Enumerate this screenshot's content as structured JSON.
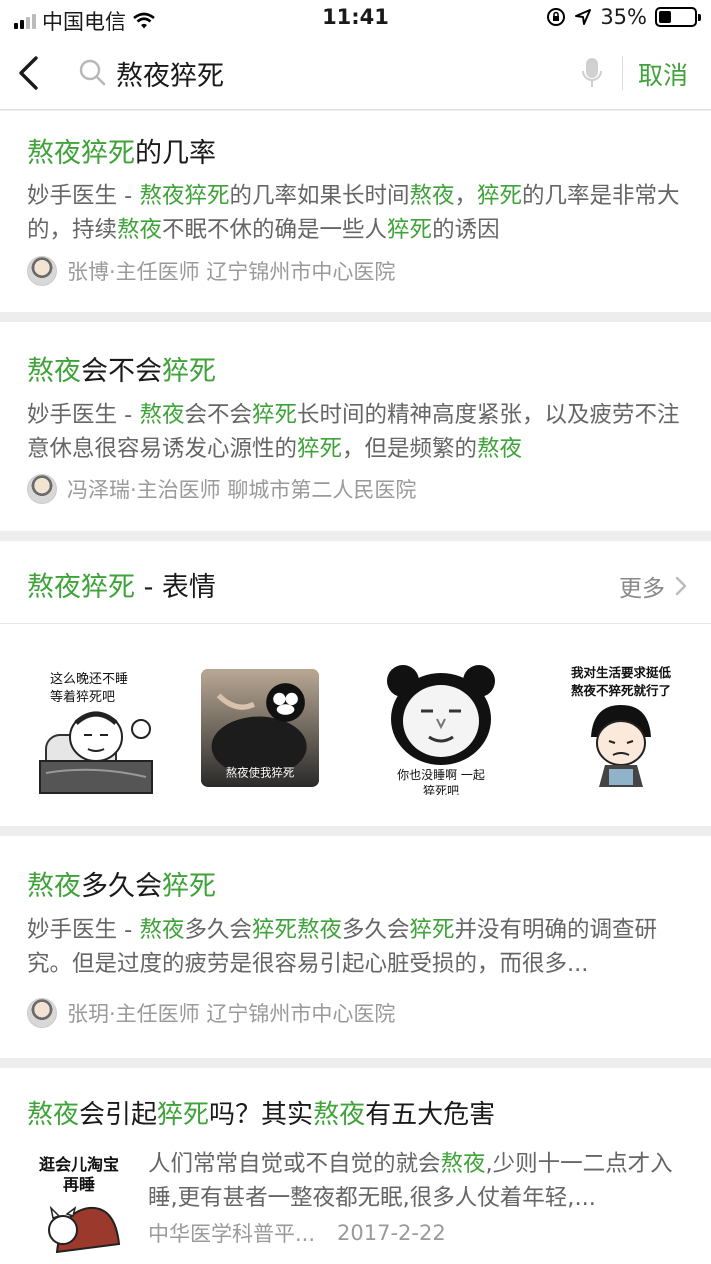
{
  "status_bar": {
    "carrier": "中国电信",
    "time": "11:41",
    "battery_percent": "35%",
    "battery_level": 0.35
  },
  "header": {
    "back_icon": "chevron-left-icon",
    "search_icon": "search-icon",
    "query": "熬夜猝死",
    "mic_icon": "mic-icon",
    "cancel_label": "取消"
  },
  "colors": {
    "accent": "#3fa33a",
    "text": "#1a1a1a",
    "muted": "#9a9a9a",
    "background": "#ededed"
  },
  "results": [
    {
      "title_parts": [
        {
          "text": "熬夜猝死",
          "hl": true
        },
        {
          "text": "的几率",
          "hl": false
        }
      ],
      "snippet_parts": [
        {
          "text": "妙手医生 - ",
          "hl": false
        },
        {
          "text": "熬夜猝死",
          "hl": true
        },
        {
          "text": "的几率如果长时间",
          "hl": false
        },
        {
          "text": "熬夜",
          "hl": true
        },
        {
          "text": "，",
          "hl": false
        },
        {
          "text": "猝死",
          "hl": true
        },
        {
          "text": "的几率是非常大的，持续",
          "hl": false
        },
        {
          "text": "熬夜",
          "hl": true
        },
        {
          "text": "不眠不休的确是一些人",
          "hl": false
        },
        {
          "text": "猝死",
          "hl": true
        },
        {
          "text": "的诱因",
          "hl": false
        }
      ],
      "author": "张博·主任医师  辽宁锦州市中心医院"
    },
    {
      "title_parts": [
        {
          "text": "熬夜",
          "hl": true
        },
        {
          "text": "会不会",
          "hl": false
        },
        {
          "text": "猝死",
          "hl": true
        }
      ],
      "snippet_parts": [
        {
          "text": "妙手医生 - ",
          "hl": false
        },
        {
          "text": "熬夜",
          "hl": true
        },
        {
          "text": "会不会",
          "hl": false
        },
        {
          "text": "猝死",
          "hl": true
        },
        {
          "text": "长时间的精神高度紧张，以及疲劳不注意休息很容易诱发心源性的",
          "hl": false
        },
        {
          "text": "猝死",
          "hl": true
        },
        {
          "text": "，但是频繁的",
          "hl": false
        },
        {
          "text": "熬夜",
          "hl": true
        }
      ],
      "author": "冯泽瑞·主治医师  聊城市第二人民医院"
    }
  ],
  "stickers": {
    "title_parts": [
      {
        "text": "熬夜猝死",
        "hl": true
      },
      {
        "text": " - 表情",
        "hl": false
      }
    ],
    "more_label": "更多",
    "more_icon": "chevron-right-icon",
    "items": [
      {
        "caption": "这么晚还不睡等着猝死吧",
        "icon": "sleeping-man-sticker"
      },
      {
        "caption": "熬夜使我猝死",
        "icon": "bear-sticker"
      },
      {
        "caption": "你也没睡啊 一起猝死吧",
        "icon": "panda-sticker"
      },
      {
        "caption": "我对生活要求挺低熬夜不猝死就行了",
        "icon": "crying-girl-sticker"
      }
    ]
  },
  "results2": [
    {
      "title_parts": [
        {
          "text": "熬夜",
          "hl": true
        },
        {
          "text": "多久会",
          "hl": false
        },
        {
          "text": "猝死",
          "hl": true
        }
      ],
      "snippet_parts": [
        {
          "text": "妙手医生 - ",
          "hl": false
        },
        {
          "text": "熬夜",
          "hl": true
        },
        {
          "text": "多久会",
          "hl": false
        },
        {
          "text": "猝死熬夜",
          "hl": true
        },
        {
          "text": "多久会",
          "hl": false
        },
        {
          "text": "猝死",
          "hl": true
        },
        {
          "text": "并没有明确的调查研究。但是过度的疲劳是很容易引起心脏受损的，而很多...",
          "hl": false
        }
      ],
      "author": "张玥·主任医师  辽宁锦州市中心医院"
    }
  ],
  "article": {
    "title_parts": [
      {
        "text": "熬夜",
        "hl": true
      },
      {
        "text": "会引起",
        "hl": false
      },
      {
        "text": "猝死",
        "hl": true
      },
      {
        "text": "吗？其实",
        "hl": false
      },
      {
        "text": "熬夜",
        "hl": true
      },
      {
        "text": "有五大危害",
        "hl": false
      }
    ],
    "thumb_caption": "逛会儿淘宝再睡",
    "snippet_parts": [
      {
        "text": "人们常常自觉或不自觉的就会",
        "hl": false
      },
      {
        "text": "熬夜",
        "hl": true
      },
      {
        "text": ",少则十一二点才入睡,更有甚者一整夜都无眠,很多人仗着年轻,...",
        "hl": false
      }
    ],
    "source": "中华医学科普平...",
    "date": "2017-2-22"
  }
}
